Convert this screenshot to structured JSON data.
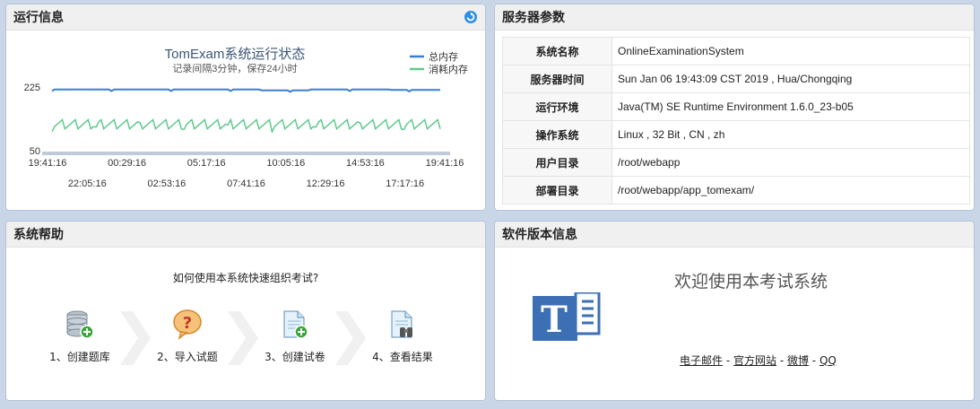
{
  "runinfo": {
    "title": "运行信息",
    "refresh_icon": "refresh-icon"
  },
  "chart_data": {
    "type": "line",
    "title": "TomExam系统运行状态",
    "subtitle": "记录间隔3分钟，保存24小时",
    "yticks": [
      225,
      50
    ],
    "ylim": [
      50,
      225
    ],
    "xticks_row1": [
      "19:41:16",
      "00:29:16",
      "05:17:16",
      "10:05:16",
      "14:53:16",
      "19:41:16"
    ],
    "xticks_row2": [
      "22:05:16",
      "02:53:16",
      "07:41:16",
      "12:29:16",
      "17:17:16"
    ],
    "series": [
      {
        "name": "总内存",
        "color": "#3a7fcf",
        "approx_value": 218
      },
      {
        "name": "消耗内存",
        "color": "#5fc98c",
        "approx_range": [
          110,
          135
        ]
      }
    ]
  },
  "server": {
    "title": "服务器参数",
    "rows": [
      {
        "key": "系统名称",
        "value": "OnlineExaminationSystem"
      },
      {
        "key": "服务器时间",
        "value": "Sun Jan 06 19:43:09 CST 2019 , Hua/Chongqing"
      },
      {
        "key": "运行环境",
        "value": "Java(TM) SE Runtime Environment 1.6.0_23-b05"
      },
      {
        "key": "操作系统",
        "value": "Linux , 32 Bit , CN , zh"
      },
      {
        "key": "用户目录",
        "value": "/root/webapp"
      },
      {
        "key": "部署目录",
        "value": "/root/webapp/app_tomexam/"
      }
    ]
  },
  "help": {
    "title": "系统帮助",
    "question": "如何使用本系统快速组织考试?",
    "steps": [
      {
        "label": "1、创建题库",
        "icon": "database-add-icon"
      },
      {
        "label": "2、导入试题",
        "icon": "question-bubble-icon"
      },
      {
        "label": "3、创建试卷",
        "icon": "document-add-icon"
      },
      {
        "label": "4、查看结果",
        "icon": "document-binoculars-icon"
      }
    ]
  },
  "version": {
    "title": "软件版本信息",
    "welcome": "欢迎使用本考试系统",
    "logo_letter": "T",
    "links": [
      "电子邮件",
      "官方网站",
      "微博",
      "QQ"
    ],
    "separator": " - "
  }
}
